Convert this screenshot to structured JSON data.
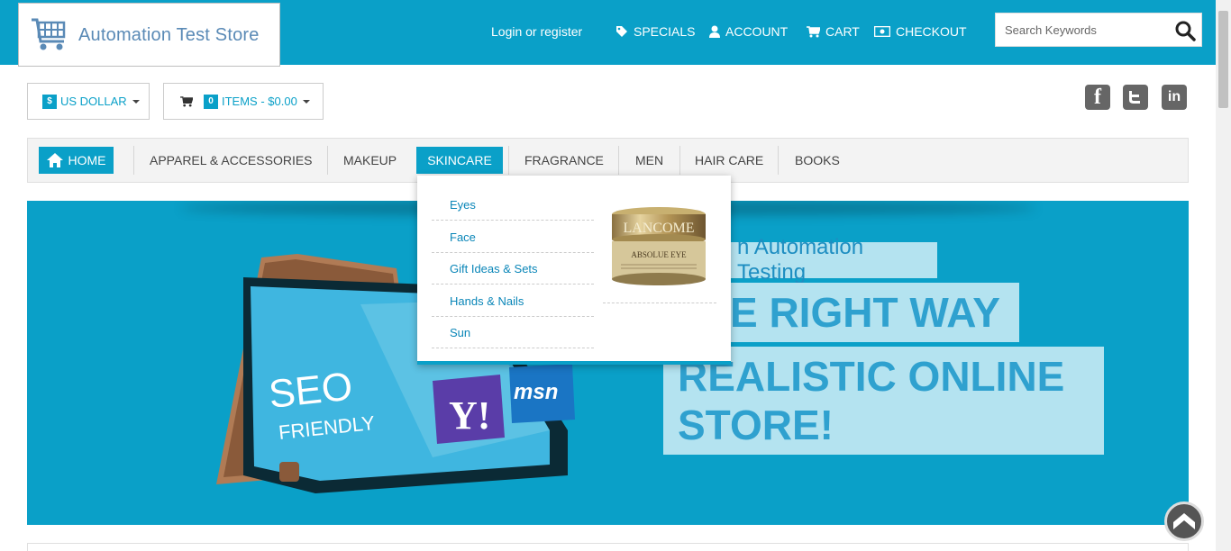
{
  "header": {
    "logo_text": "Automation Test Store",
    "login_text": "Login or register",
    "nav": [
      {
        "label": "SPECIALS",
        "icon": "tag-icon"
      },
      {
        "label": "ACCOUNT",
        "icon": "user-icon"
      },
      {
        "label": "CART",
        "icon": "cart-icon"
      },
      {
        "label": "CHECKOUT",
        "icon": "money-icon"
      }
    ],
    "search_placeholder": "Search Keywords"
  },
  "currency": {
    "symbol": "$",
    "label": "US DOLLAR"
  },
  "cart_summary": {
    "count": "0",
    "label": "ITEMS - $0.00"
  },
  "social": [
    "facebook-icon",
    "twitter-icon",
    "linkedin-icon"
  ],
  "categories": [
    {
      "label": "HOME"
    },
    {
      "label": "APPAREL & ACCESSORIES"
    },
    {
      "label": "MAKEUP"
    },
    {
      "label": "SKINCARE"
    },
    {
      "label": "FRAGRANCE"
    },
    {
      "label": "MEN"
    },
    {
      "label": "HAIR CARE"
    },
    {
      "label": "BOOKS"
    }
  ],
  "dropdown": {
    "items": [
      "Eyes",
      "Face",
      "Gift Ideas & Sets",
      "Hands & Nails",
      "Sun"
    ],
    "product_brand": "LANCOME",
    "product_name": "ABSOLUE EYE"
  },
  "hero": {
    "subtitle": "n Automation Testing",
    "line1": "E RIGHT WAY",
    "line2": "REALISTIC ONLINE STORE!",
    "screen_text1": "SEO",
    "screen_text2": "FRIENDLY",
    "tile1": "Y!",
    "tile2": "msn"
  },
  "colors": {
    "accent": "#0aa0c8",
    "hero_text_bg": "#b4e3f0",
    "hero_text": "#2fa1cf"
  }
}
